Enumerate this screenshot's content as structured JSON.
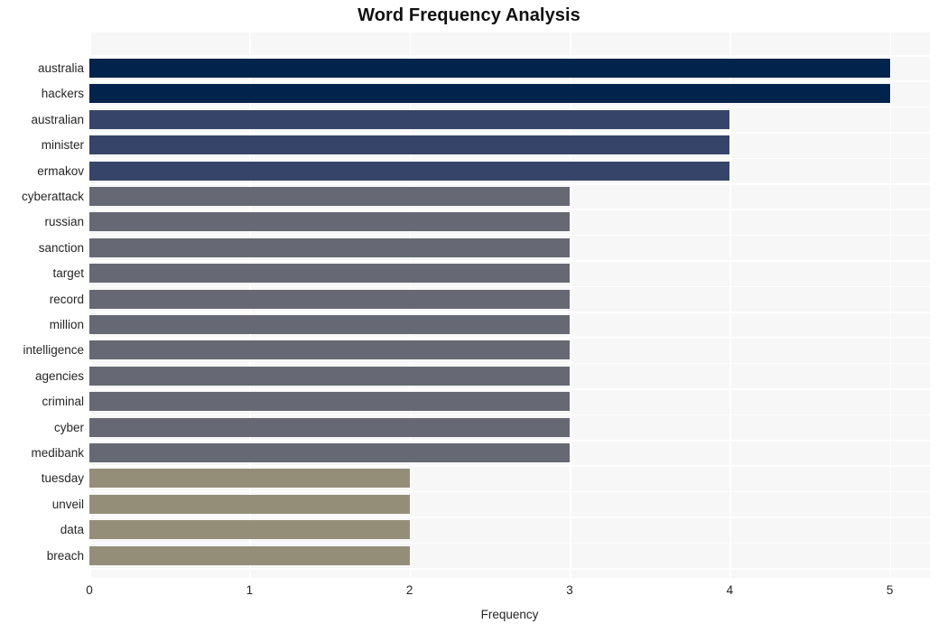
{
  "chart_data": {
    "type": "bar",
    "orientation": "horizontal",
    "title": "Word Frequency Analysis",
    "xlabel": "Frequency",
    "ylabel": "",
    "xlim": [
      0,
      5.25
    ],
    "xticks": [
      0,
      1,
      2,
      3,
      4,
      5
    ],
    "xtick_labels": [
      "0",
      "1",
      "2",
      "3",
      "4",
      "5"
    ],
    "grid": true,
    "grid_color": "#ffffff",
    "plot_background": "#f7f7f7",
    "figure_background": "#ffffff",
    "legend": null,
    "categories": [
      "australia",
      "hackers",
      "australian",
      "minister",
      "ermakov",
      "cyberattack",
      "russian",
      "sanction",
      "target",
      "record",
      "million",
      "intelligence",
      "agencies",
      "criminal",
      "cyber",
      "medibank",
      "tuesday",
      "unveil",
      "data",
      "breach"
    ],
    "values": [
      5,
      5,
      4,
      4,
      4,
      3,
      3,
      3,
      3,
      3,
      3,
      3,
      3,
      3,
      3,
      3,
      2,
      2,
      2,
      2
    ],
    "bar_colors": [
      "#02234c",
      "#02234c",
      "#364469",
      "#364469",
      "#364469",
      "#666973",
      "#666973",
      "#666973",
      "#666973",
      "#666973",
      "#666973",
      "#666973",
      "#666973",
      "#666973",
      "#666973",
      "#666973",
      "#948e79",
      "#948e79",
      "#948e79",
      "#948e79"
    ],
    "palette": {
      "value_5": "#02234c",
      "value_4": "#364469",
      "value_3": "#666973",
      "value_2": "#948e79"
    }
  }
}
